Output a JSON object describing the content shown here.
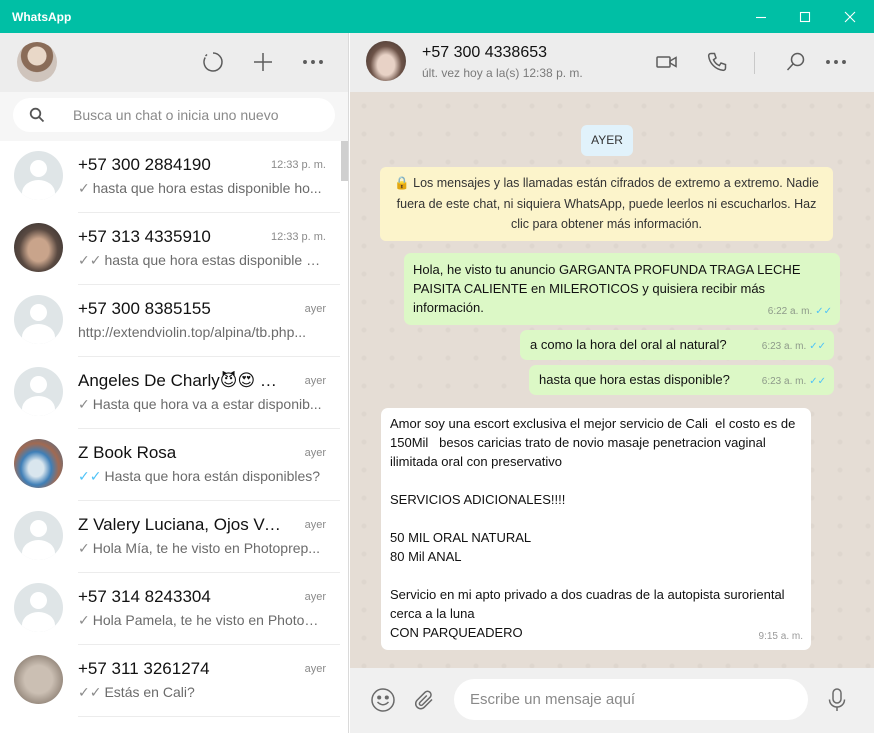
{
  "window": {
    "title": "WhatsApp"
  },
  "icons": {
    "new_status": "status-icon",
    "new_chat": "plus-icon",
    "menu": "more-icon",
    "search": "search-icon",
    "video": "video-call-icon",
    "call": "phone-icon",
    "emoji": "emoji-icon",
    "attach": "paperclip-icon",
    "mic": "microphone-icon"
  },
  "colors": {
    "accent": "#00bfa5",
    "outgoing": "#dcf8c6",
    "read_tick": "#4fc3f7",
    "notice": "#fcf4cb"
  },
  "search": {
    "placeholder": "Busca un chat o inicia uno nuevo"
  },
  "chats": [
    {
      "name": "+57 300 2884190",
      "time": "12:33 p. m.",
      "tick": "✓",
      "tick_color": "grey",
      "preview": "hasta que hora estas disponible ho...",
      "avatar": "default"
    },
    {
      "name": "+57 313 4335910",
      "time": "12:33 p. m.",
      "tick": "✓✓",
      "tick_color": "grey",
      "preview": "hasta que hora estas disponible h...",
      "avatar": "photo-1"
    },
    {
      "name": "+57 300 8385155",
      "time": "ayer",
      "tick": "",
      "tick_color": "grey",
      "preview": "http://extendviolin.top/alpina/tb.php...",
      "avatar": "default"
    },
    {
      "name": "Angeles De Charly😈😍 Lo...",
      "time": "ayer",
      "tick": "✓",
      "tick_color": "grey",
      "preview": "Hasta que hora va a estar disponib...",
      "avatar": "default"
    },
    {
      "name": "Z Book Rosa",
      "time": "ayer",
      "tick": "✓✓",
      "tick_color": "blue",
      "preview": "Hasta que hora están disponibles?",
      "avatar": "photo-2"
    },
    {
      "name": "Z Valery Luciana, Ojos Ver...",
      "time": "ayer",
      "tick": "✓",
      "tick_color": "grey",
      "preview": "Hola Mía, te he visto en Photoprep...",
      "avatar": "default"
    },
    {
      "name": "+57 314 8243304",
      "time": "ayer",
      "tick": "✓",
      "tick_color": "grey",
      "preview": "Hola Pamela, te he visto en Photop...",
      "avatar": "default"
    },
    {
      "name": "+57 311 3261274",
      "time": "ayer",
      "tick": "✓✓",
      "tick_color": "grey",
      "preview": "Estás en Cali?",
      "avatar": "photo-3"
    }
  ],
  "contact": {
    "name": "+57 300 4338653",
    "status": "últ. vez hoy a la(s) 12:38 p. m."
  },
  "conversation": {
    "day": "AYER",
    "notice": "🔒 Los mensajes y las llamadas están cifrados de extremo a extremo. Nadie fuera de este chat, ni siquiera WhatsApp, puede leerlos ni escucharlos. Haz clic para obtener más información.",
    "messages": [
      {
        "dir": "out",
        "text": "Hola, he visto tu anuncio GARGANTA PROFUNDA TRAGA LECHE PAISITA CALIENTE en MILEROTICOS y quisiera recibir más información.",
        "time": "6:22 a. m.",
        "tick": "✓✓"
      },
      {
        "dir": "out",
        "text": "a como la hora del oral al natural?",
        "time": "6:23 a. m.",
        "tick": "✓✓"
      },
      {
        "dir": "out",
        "text": "hasta que hora estas disponible?",
        "time": "6:23 a. m.",
        "tick": "✓✓"
      },
      {
        "dir": "in",
        "text": "Amor soy una escort exclusiva el mejor servicio de Cali  el costo es de 150Mil   besos caricias trato de novio masaje penetracion vaginal ilimitada oral con preservativo\n\nSERVICIOS ADICIONALES!!!!\n\n50 MIL ORAL NATURAL\n80 Mil ANAL\n\nServicio en mi apto privado a dos cuadras de la autopista suroriental cerca a la luna\nCON PARQUEADERO",
        "time": "9:15 a. m.",
        "tick": ""
      }
    ]
  },
  "composer": {
    "placeholder": "Escribe un mensaje aquí"
  }
}
